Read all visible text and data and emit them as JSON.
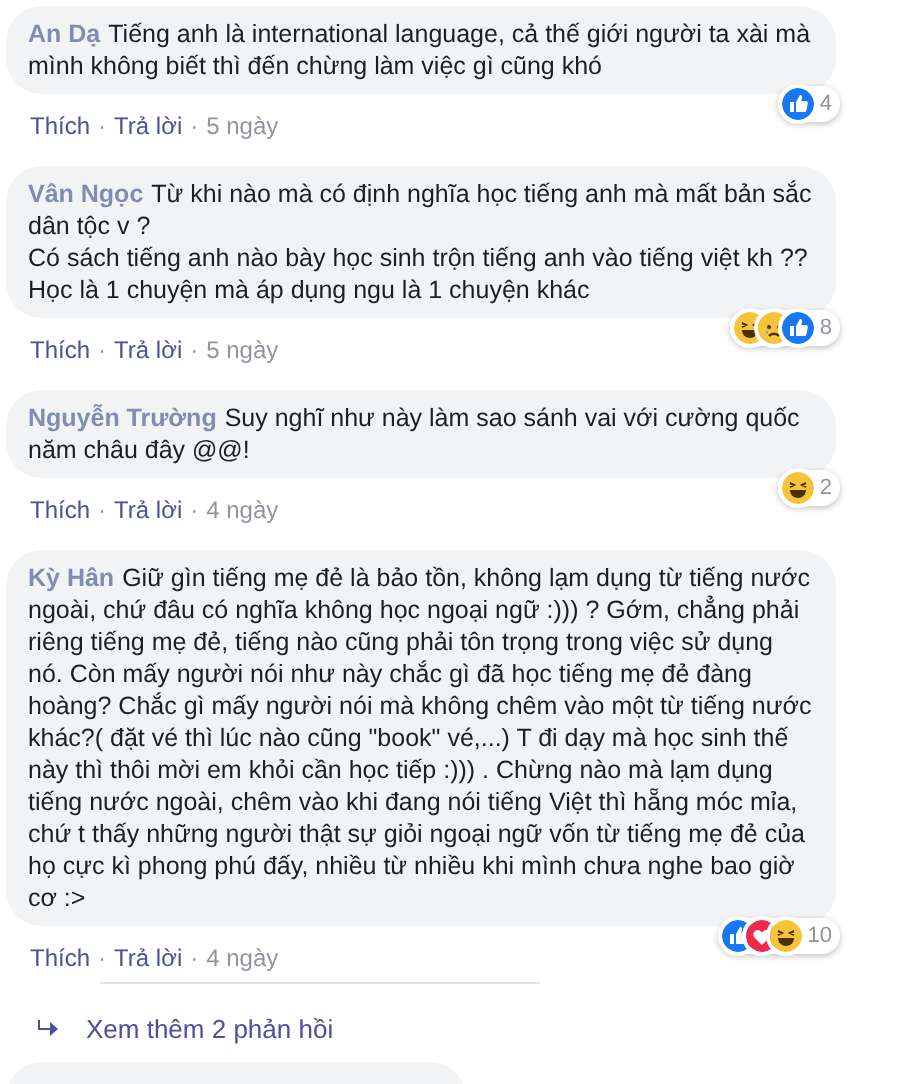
{
  "comments": [
    {
      "author": "An Dạ",
      "paragraphs": [
        "Tiếng anh là international language, cả thế giới người ta xài mà mình không biết thì đến chừng làm việc gì cũng khó"
      ],
      "reactions": [
        {
          "kind": "like"
        }
      ],
      "reaction_count": "4",
      "actions": [
        "Thích",
        "Trả lời"
      ],
      "separator": "·",
      "time": "5 ngày"
    },
    {
      "author": "Vân Ngọc",
      "paragraphs": [
        "Từ khi nào mà có định nghĩa học tiếng anh mà mất bản sắc dân tộc v ?",
        "Có sách tiếng anh nào bày học sinh trộn tiếng anh vào tiếng việt kh ?? Học là 1 chuyện mà áp dụng ngu là 1 chuyện khác"
      ],
      "reactions": [
        {
          "kind": "haha"
        },
        {
          "kind": "sad"
        },
        {
          "kind": "like"
        }
      ],
      "reaction_count": "8",
      "actions": [
        "Thích",
        "Trả lời"
      ],
      "separator": "·",
      "time": "5 ngày"
    },
    {
      "author": "Nguyễn Trường",
      "paragraphs": [
        "Suy nghĩ như này làm sao sánh vai với cường quốc năm châu đây @@!"
      ],
      "reactions": [
        {
          "kind": "haha"
        }
      ],
      "reaction_count": "2",
      "actions": [
        "Thích",
        "Trả lời"
      ],
      "separator": "·",
      "time": "4 ngày"
    },
    {
      "author": "Kỳ Hân",
      "paragraphs": [
        "Giữ gìn tiếng mẹ đẻ là bảo tồn, không lạm dụng từ tiếng nước ngoài, chứ đâu có nghĩa không học ngoại ngữ :))) ? Gớm, chẳng phải riêng tiếng mẹ đẻ, tiếng nào cũng phải tôn trọng trong việc sử dụng nó. Còn mấy người nói như này chắc gì đã học tiếng mẹ đẻ đàng hoàng? Chắc gì mấy người nói mà không chêm vào một từ tiếng nước khác?( đặt vé thì lúc nào cũng \"book\" vé,...) T đi dạy mà học sinh thế này thì thôi mời em khỏi cần học tiếp :))) . Chừng nào mà lạm dụng tiếng nước ngoài, chêm vào khi đang nói tiếng Việt thì hẵng móc mỉa, chứ t thấy những người thật sự giỏi ngoại ngữ vốn từ tiếng mẹ đẻ của họ cực kì phong phú đấy, nhiều từ nhiều khi mình chưa nghe bao giờ cơ :>"
      ],
      "reactions": [
        {
          "kind": "like"
        },
        {
          "kind": "love"
        },
        {
          "kind": "haha"
        }
      ],
      "reaction_count": "10",
      "actions": [
        "Thích",
        "Trả lời"
      ],
      "separator": "·",
      "time": "4 ngày"
    }
  ],
  "more_replies": "Xem thêm 2 phản hồi"
}
